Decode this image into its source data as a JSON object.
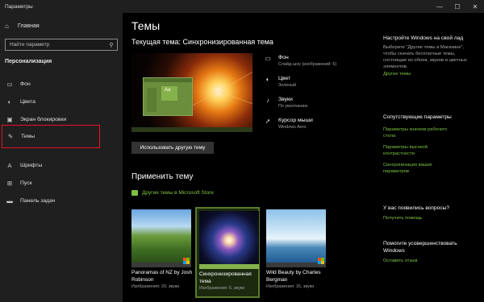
{
  "window": {
    "title": "Параметры",
    "controls": [
      "—",
      "☐",
      "✕"
    ]
  },
  "sidebar": {
    "home_label": "Главная",
    "search_placeholder": "Найти параметр",
    "section": "Персонализация",
    "items": [
      {
        "label": "Фон",
        "icon": "picture-icon",
        "glyph": "▭"
      },
      {
        "label": "Цвета",
        "icon": "palette-icon",
        "glyph": "◐"
      },
      {
        "label": "Экран блокировки",
        "icon": "lock-screen-icon",
        "glyph": "▣"
      },
      {
        "label": "Темы",
        "icon": "brush-icon",
        "glyph": "✎",
        "selected": true
      },
      {
        "label": "Шрифты",
        "icon": "fonts-icon",
        "glyph": "A"
      },
      {
        "label": "Пуск",
        "icon": "start-icon",
        "glyph": "⊞"
      },
      {
        "label": "Панель задач",
        "icon": "taskbar-icon",
        "glyph": "▬"
      }
    ]
  },
  "main": {
    "title": "Темы",
    "current_theme": "Текущая тема: Синхронизированная тема",
    "preview_tile": "Aa",
    "properties": [
      {
        "title": "Фон",
        "sub": "Слайд-шоу (изображений: 6)",
        "icon": "picture-icon",
        "glyph": "▭"
      },
      {
        "title": "Цвет",
        "sub": "Зеленый",
        "icon": "palette-icon",
        "glyph": "◐"
      },
      {
        "title": "Звуки",
        "sub": "По умолчанию",
        "icon": "sound-icon",
        "glyph": "♪"
      },
      {
        "title": "Курсор мыши",
        "sub": "Windows Aero",
        "icon": "cursor-icon",
        "glyph": "➚"
      }
    ],
    "use_theme_button": "Использовать другую тему",
    "apply_title": "Применить тему",
    "store_link": "Другие темы в Microsoft Store",
    "themes": [
      {
        "title": "Panoramas of NZ by Josh Robinson",
        "sub": "Изображения: 20, звуки",
        "bar_color": "#3a3a3a"
      },
      {
        "title": "Синхронизированная тема",
        "sub": "Изображения: 6, звуки",
        "bar_color": "#86b24c"
      },
      {
        "title": "Wild Beauty by Charles Bergman",
        "sub": "Изображения: 16, звуки",
        "bar_color": "#3a3a3a"
      }
    ]
  },
  "right": {
    "setup_title": "Настройте Windows на свой лад",
    "setup_text": "Выберите \"Другие темы в Магазине\", чтобы скачать бесплатные темы, состоящие из обоев, звуков и цветных элементов.",
    "setup_link": "Другие темы",
    "related_title": "Сопутствующие параметры",
    "related_links": [
      "Параметры значков рабочего стола",
      "Параметры высокой контрастности",
      "Синхронизация ваших параметров"
    ],
    "question_title": "У вас появились вопросы?",
    "question_link": "Получить помощь",
    "improve_title": "Помогите усовершенствовать Windows",
    "improve_link": "Оставить отзыв"
  }
}
